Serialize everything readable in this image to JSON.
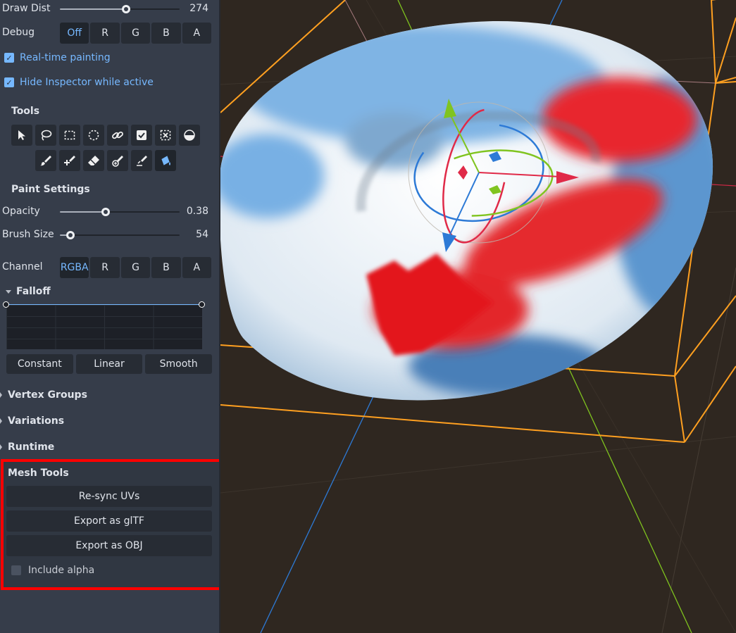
{
  "panel": {
    "draw_dist": {
      "label": "Draw Dist",
      "value": "274",
      "fraction": 0.55
    },
    "debug": {
      "label": "Debug",
      "options": [
        "Off",
        "R",
        "G",
        "B",
        "A"
      ],
      "selected": "Off"
    },
    "realtime_painting": {
      "label": "Real-time painting",
      "checked": true
    },
    "hide_inspector": {
      "label": "Hide Inspector while active",
      "checked": true
    },
    "tools": {
      "label": "Tools",
      "row1": [
        "select-icon",
        "lasso-icon",
        "rect-select-icon",
        "circle-select-icon",
        "link-icon",
        "checkbox-icon",
        "deselect-icon",
        "half-circle-icon"
      ],
      "row2": [
        "brush-icon",
        "brush-add-icon",
        "eraser-icon",
        "smudge-icon",
        "blur-icon",
        "fill-icon"
      ],
      "active": "fill-icon"
    },
    "paint_settings": {
      "label": "Paint Settings",
      "opacity": {
        "label": "Opacity",
        "value": "0.38",
        "fraction": 0.38
      },
      "brush_size": {
        "label": "Brush Size",
        "value": "54",
        "fraction": 0.09
      },
      "channel": {
        "label": "Channel",
        "options": [
          "RGBA",
          "R",
          "G",
          "B",
          "A"
        ],
        "selected": "RGBA"
      }
    },
    "falloff": {
      "label": "Falloff",
      "buttons": [
        "Constant",
        "Linear",
        "Smooth"
      ]
    },
    "sections": [
      "Vertex Groups",
      "Variations",
      "Runtime"
    ],
    "mesh_tools": {
      "label": "Mesh Tools",
      "resync": "Re-sync UVs",
      "export_gltf": "Export as glTF",
      "export_obj": "Export as OBJ",
      "include_alpha": {
        "label": "Include alpha",
        "checked": false
      }
    }
  },
  "colors": {
    "accent": "#76b8ff",
    "panel_bg": "#363d4a",
    "viewport_bg": "#2f2720",
    "highlight": "#ff0000",
    "bbox": "#ffa020"
  }
}
